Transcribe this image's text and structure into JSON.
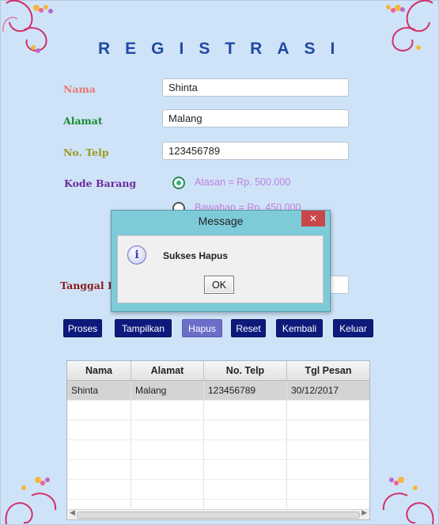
{
  "form": {
    "title": "REGISTRASI",
    "labels": {
      "nama": "Nama",
      "alamat": "Alamat",
      "telp": "No. Telp",
      "kode": "Kode Barang",
      "tanggal_partial": "Tanggal P"
    },
    "label_colors": {
      "nama": "#ee7777",
      "alamat": "#1a8a2e",
      "telp": "#9a9a1e",
      "kode": "#6b2a9a",
      "tanggal": "#8a1a1a"
    },
    "values": {
      "nama": "Shinta",
      "alamat": "Malang",
      "telp": "123456789"
    },
    "radio_options": [
      {
        "label": "Atasan = Rp. 500.000",
        "selected": true
      },
      {
        "label": "Bawahan = Rp. 450.000",
        "selected": false
      }
    ]
  },
  "buttons": [
    "Proses",
    "Tampilkan",
    "Hapus",
    "Reset",
    "Kembali",
    "Keluar"
  ],
  "table": {
    "columns": [
      "Nama",
      "Alamat",
      "No. Telp",
      "Tgl Pesan"
    ],
    "rows": [
      [
        "Shinta",
        "Malang",
        "123456789",
        "30/12/2017"
      ]
    ],
    "empty_rows": 6
  },
  "dialog": {
    "title": "Message",
    "message": "Sukses Hapus",
    "ok_label": "OK",
    "close_glyph": "✕",
    "icon": "info-icon"
  },
  "colors": {
    "background": "#cfe3f8",
    "title": "#1f4aa3",
    "button": "#0d1a7c",
    "button_active": "#6a6ec8",
    "dialog_frame": "#7dcbd9",
    "close_button": "#c9474a"
  }
}
